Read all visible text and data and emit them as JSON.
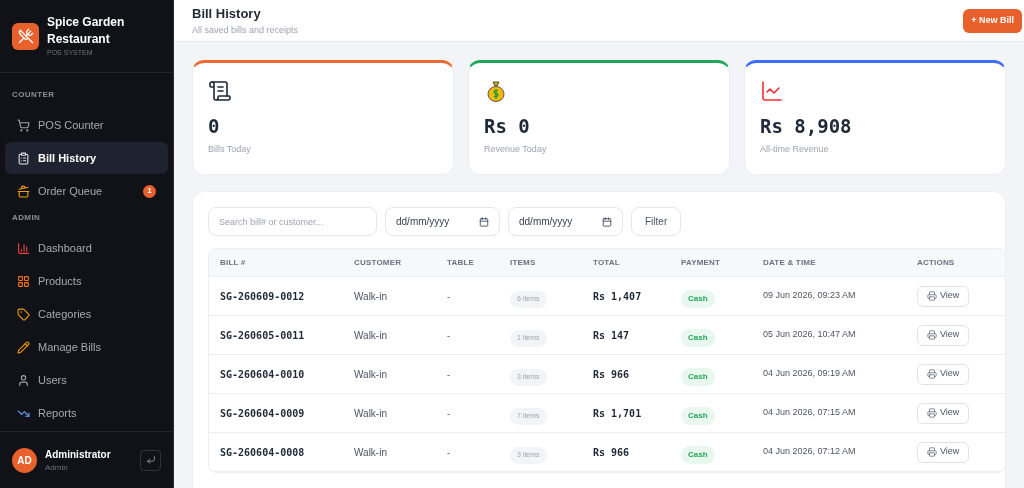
{
  "brand": {
    "name": "Spice Garden Restaurant",
    "subtitle": "POS SYSTEM"
  },
  "sidebar": {
    "sections": [
      {
        "heading": "COUNTER",
        "items": [
          {
            "label": "POS Counter",
            "selected": false
          },
          {
            "label": "Bill History",
            "selected": true
          },
          {
            "label": "Order Queue",
            "selected": false,
            "badge": "1"
          }
        ]
      },
      {
        "heading": "ADMIN",
        "items": [
          {
            "label": "Dashboard",
            "selected": false
          },
          {
            "label": "Products",
            "selected": false
          },
          {
            "label": "Categories",
            "selected": false
          },
          {
            "label": "Manage Bills",
            "selected": false
          },
          {
            "label": "Users",
            "selected": false
          },
          {
            "label": "Reports",
            "selected": false
          }
        ]
      }
    ],
    "user": {
      "initials": "AD",
      "name": "Administrator",
      "role": "Admin"
    }
  },
  "header": {
    "title": "Bill History",
    "subtitle": "All saved bills and receipts",
    "new_button": "+ New Bill"
  },
  "stats": [
    {
      "value": "0",
      "label": "Bills Today",
      "color": "#ea6a2f"
    },
    {
      "value": "Rs 0",
      "label": "Revenue Today",
      "color": "#22a45a"
    },
    {
      "value": "Rs 8,908",
      "label": "All-time Revenue",
      "color": "#3b6ef5"
    }
  ],
  "filters": {
    "search_placeholder": "Search bill# or customer...",
    "date_from": "dd/mm/yyyy",
    "date_to": "dd/mm/yyyy",
    "filter_button": "Filter"
  },
  "table": {
    "columns": [
      "BILL #",
      "CUSTOMER",
      "TABLE",
      "ITEMS",
      "TOTAL",
      "PAYMENT",
      "DATE & TIME",
      "ACTIONS"
    ],
    "rows": [
      {
        "bill": "SG-260609-0012",
        "customer": "Walk-in",
        "table": "-",
        "items": "6 items",
        "total": "Rs 1,407",
        "payment": "Cash",
        "datetime": "09 Jun 2026, 09:23 AM",
        "action": "View"
      },
      {
        "bill": "SG-260605-0011",
        "customer": "Walk-in",
        "table": "-",
        "items": "1 items",
        "total": "Rs 147",
        "payment": "Cash",
        "datetime": "05 Jun 2026, 10:47 AM",
        "action": "View"
      },
      {
        "bill": "SG-260604-0010",
        "customer": "Walk-in",
        "table": "-",
        "items": "3 items",
        "total": "Rs 966",
        "payment": "Cash",
        "datetime": "04 Jun 2026, 09:19 AM",
        "action": "View"
      },
      {
        "bill": "SG-260604-0009",
        "customer": "Walk-in",
        "table": "-",
        "items": "7 items",
        "total": "Rs 1,701",
        "payment": "Cash",
        "datetime": "04 Jun 2026, 07:15 AM",
        "action": "View"
      },
      {
        "bill": "SG-260604-0008",
        "customer": "Walk-in",
        "table": "-",
        "items": "3 items",
        "total": "Rs 966",
        "payment": "Cash",
        "datetime": "04 Jun 2026, 07:12 AM",
        "action": "View"
      }
    ]
  }
}
